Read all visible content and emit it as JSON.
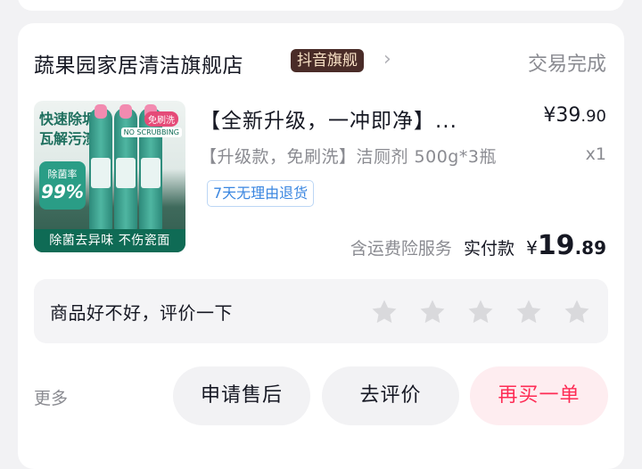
{
  "shop": {
    "name": "蔬果园家居清洁旗舰店",
    "badge": "抖音旗舰",
    "status": "交易完成"
  },
  "product": {
    "image_texts": {
      "headline": "快速除垢瓦解污渍",
      "rate_label": "除菌率",
      "rate_value": "99%",
      "banner": "除菌去异味 不伤瓷面",
      "corner_tag": "免刷洗",
      "corner_tag2": "NO SCRUBBING"
    },
    "title": "【全新升级，一冲即净】...",
    "price_main": "¥39",
    "price_cents": ".90",
    "spec": "【升级款，免刷洗】洁厕剂 500g*3瓶",
    "quantity": "x1",
    "return_tag": "7天无理由退货"
  },
  "payment": {
    "insurance": "含运费险服务",
    "paid_label": "实付款",
    "currency": "¥",
    "amount_main": "19",
    "amount_cents": ".89"
  },
  "review": {
    "prompt": "商品好不好，评价一下",
    "stars_total": 5,
    "stars_selected": 0,
    "star_color": "#d9d9dc"
  },
  "actions": {
    "more": "更多",
    "after_sales": "申请售后",
    "write_review": "去评价",
    "buy_again": "再买一单"
  },
  "colors": {
    "accent": "#fe2c55",
    "badge_bg": "#4a2c28",
    "badge_text": "#f9e2c6",
    "return_tag": "#3a86e0"
  }
}
